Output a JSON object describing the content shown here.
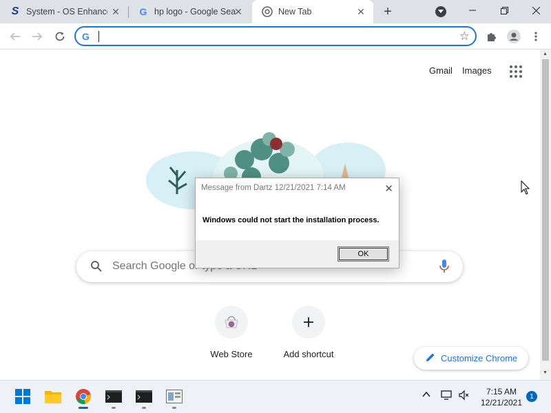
{
  "browser": {
    "tabs": [
      {
        "title": "System - OS Enhance",
        "favicon": "S"
      },
      {
        "title": "hp logo - Google Sea",
        "favicon": "G"
      },
      {
        "title": "New Tab",
        "favicon": "chrome-icon"
      }
    ],
    "omnibox": {
      "value": "",
      "placeholder": ""
    }
  },
  "newtab": {
    "top_links": {
      "gmail": "Gmail",
      "images": "Images"
    },
    "search_placeholder": "Search Google or type a URL",
    "shortcuts": [
      {
        "label": "Web Store"
      },
      {
        "label": "Add shortcut"
      }
    ],
    "customize_label": "Customize Chrome"
  },
  "dialog": {
    "title": "Message from Dartz 12/21/2021 7:14 AM",
    "message": "Windows could not start the installation process.",
    "ok_label": "OK"
  },
  "taskbar": {
    "time": "7:15 AM",
    "date": "12/21/2021",
    "notification_count": "1"
  },
  "colors": {
    "accent": "#1a73e8",
    "tabstrip": "#dee1e6",
    "taskbar": "#eef2f6"
  }
}
